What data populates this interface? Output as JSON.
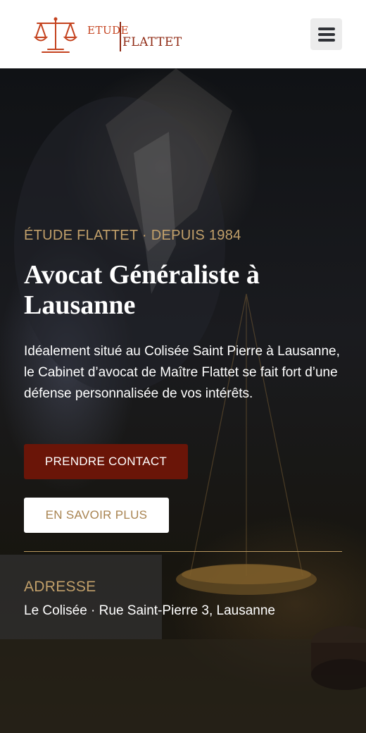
{
  "header": {
    "logo": {
      "word_1": "ETUDE",
      "word_2": "FLATTET",
      "icon": "scales-of-justice-icon",
      "color": "#c4421e"
    },
    "menu": {
      "icon": "hamburger-menu-icon"
    }
  },
  "hero": {
    "eyebrow": "ÉTUDE FLATTET · DEPUIS 1984",
    "title": "Avocat Généraliste à Lausanne",
    "description": "Idéalement situé au Colisée Saint Pierre à Lausanne, le Cabinet d’avocat de Maître Flattet se fait fort d’une défense personnalisée de vos intérêts.",
    "primary_button": "PRENDRE CONTACT",
    "secondary_button": "EN SAVOIR PLUS",
    "address_label": "ADRESSE",
    "address_value": "Le Colisée · Rue Saint-Pierre 3, Lausanne"
  },
  "colors": {
    "accent_gold": "#c2a06a",
    "primary_button_bg": "#6a1508",
    "logo_dark_red": "#8f2a14"
  }
}
